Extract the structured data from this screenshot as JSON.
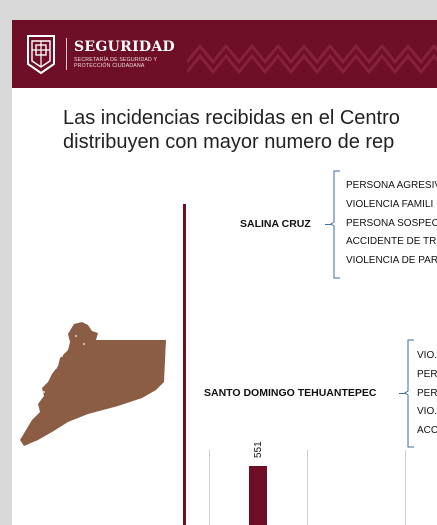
{
  "header": {
    "brand_title": "SEGURIDAD",
    "brand_sub_line1": "SECRETARÍA DE SEGURIDAD Y",
    "brand_sub_line2": "PROTECCIÓN CIUDADANA",
    "color": "#6e0f27",
    "logo_icon": "seal-icon"
  },
  "headline": {
    "line1": "Las incidencias recibidas en el Centro",
    "line2": "distribuyen con mayor numero de rep"
  },
  "sections": [
    {
      "city": "SALINA CRUZ",
      "items": [
        "PERSONA AGRESIV",
        "VIOLENCIA FAMILI",
        "PERSONA SOSPEC",
        "ACCIDENTE DE TR",
        "VIOLENCIA DE PAR"
      ]
    },
    {
      "city": "SANTO DOMINGO TEHUANTEPEC",
      "items": [
        "VIO.",
        "PERS",
        "PERS",
        "VIO.",
        "ACC"
      ]
    }
  ],
  "chart_data": {
    "type": "bar",
    "values": [
      551
    ],
    "data_labels": [
      "551"
    ]
  }
}
